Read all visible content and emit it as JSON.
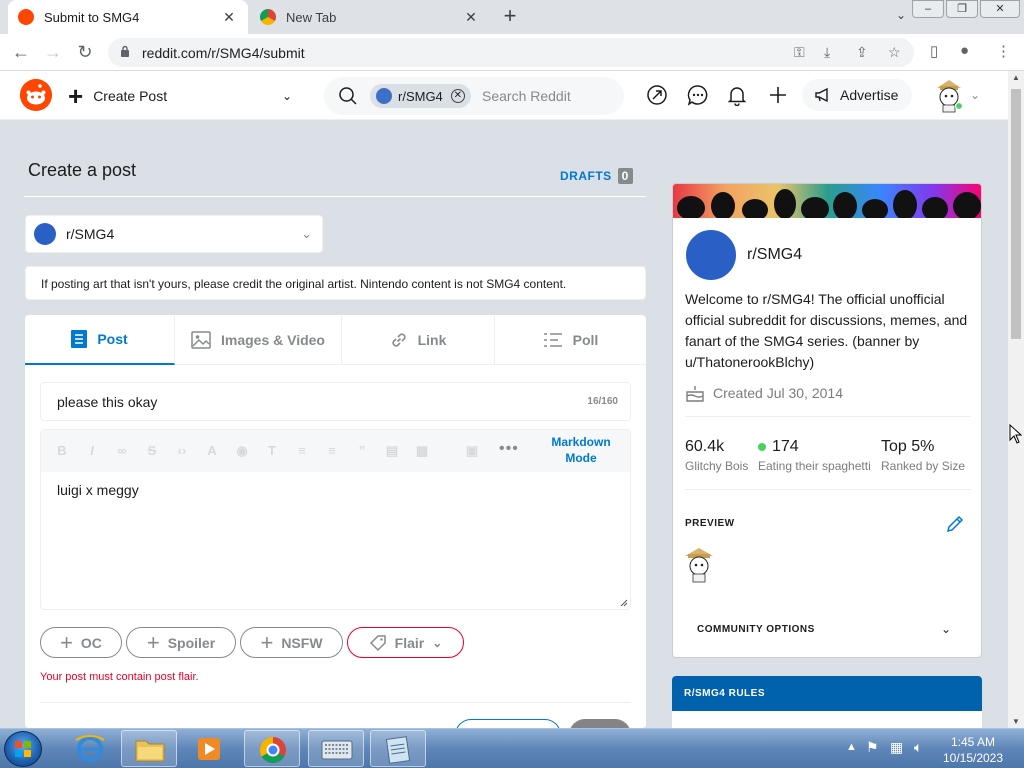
{
  "browser": {
    "tabs": [
      {
        "title": "Submit to SMG4",
        "active": true
      },
      {
        "title": "New Tab",
        "active": false
      }
    ],
    "url": "reddit.com/r/SMG4/submit"
  },
  "header": {
    "create_label": "Create Post",
    "search_chip": "r/SMG4",
    "search_placeholder": "Search Reddit",
    "advertise_label": "Advertise"
  },
  "main": {
    "title": "Create a post",
    "drafts_label": "DRAFTS",
    "drafts_count": "0",
    "community": "r/SMG4",
    "notice": "If posting art that isn't yours, please credit the original artist. Nintendo content is not SMG4 content.",
    "tabs": [
      {
        "label": "Post",
        "icon": "post-icon"
      },
      {
        "label": "Images & Video",
        "icon": "image-icon"
      },
      {
        "label": "Link",
        "icon": "link-icon"
      },
      {
        "label": "Poll",
        "icon": "poll-icon"
      }
    ],
    "post_title": "please this okay",
    "title_count": "16/160",
    "markdown_label": "Markdown Mode",
    "body_text": "luigi x meggy",
    "tags": {
      "oc": "OC",
      "spoiler": "Spoiler",
      "nsfw": "NSFW",
      "flair": "Flair"
    },
    "flair_error": "Your post must contain post flair."
  },
  "sidebar": {
    "name": "r/SMG4",
    "description": "Welcome to r/SMG4! The official unofficial official subreddit for discussions, memes, and fanart of the SMG4 series. (banner by u/ThatonerookBlchy)",
    "created": "Created Jul 30, 2014",
    "stats": [
      {
        "value": "60.4k",
        "label": "Glitchy Bois"
      },
      {
        "value": "174",
        "label": "Eating their spaghetti"
      },
      {
        "value": "Top 5%",
        "label": "Ranked by Size"
      }
    ],
    "preview_label": "PREVIEW",
    "community_options_label": "COMMUNITY OPTIONS",
    "rules_header": "R/SMG4 RULES"
  },
  "taskbar": {
    "time": "1:45 AM",
    "date": "10/15/2023"
  },
  "colors": {
    "reddit_orange": "#ff4500",
    "accent_blue": "#0079d3",
    "error_red": "#ea0027",
    "online_green": "#46d160"
  }
}
